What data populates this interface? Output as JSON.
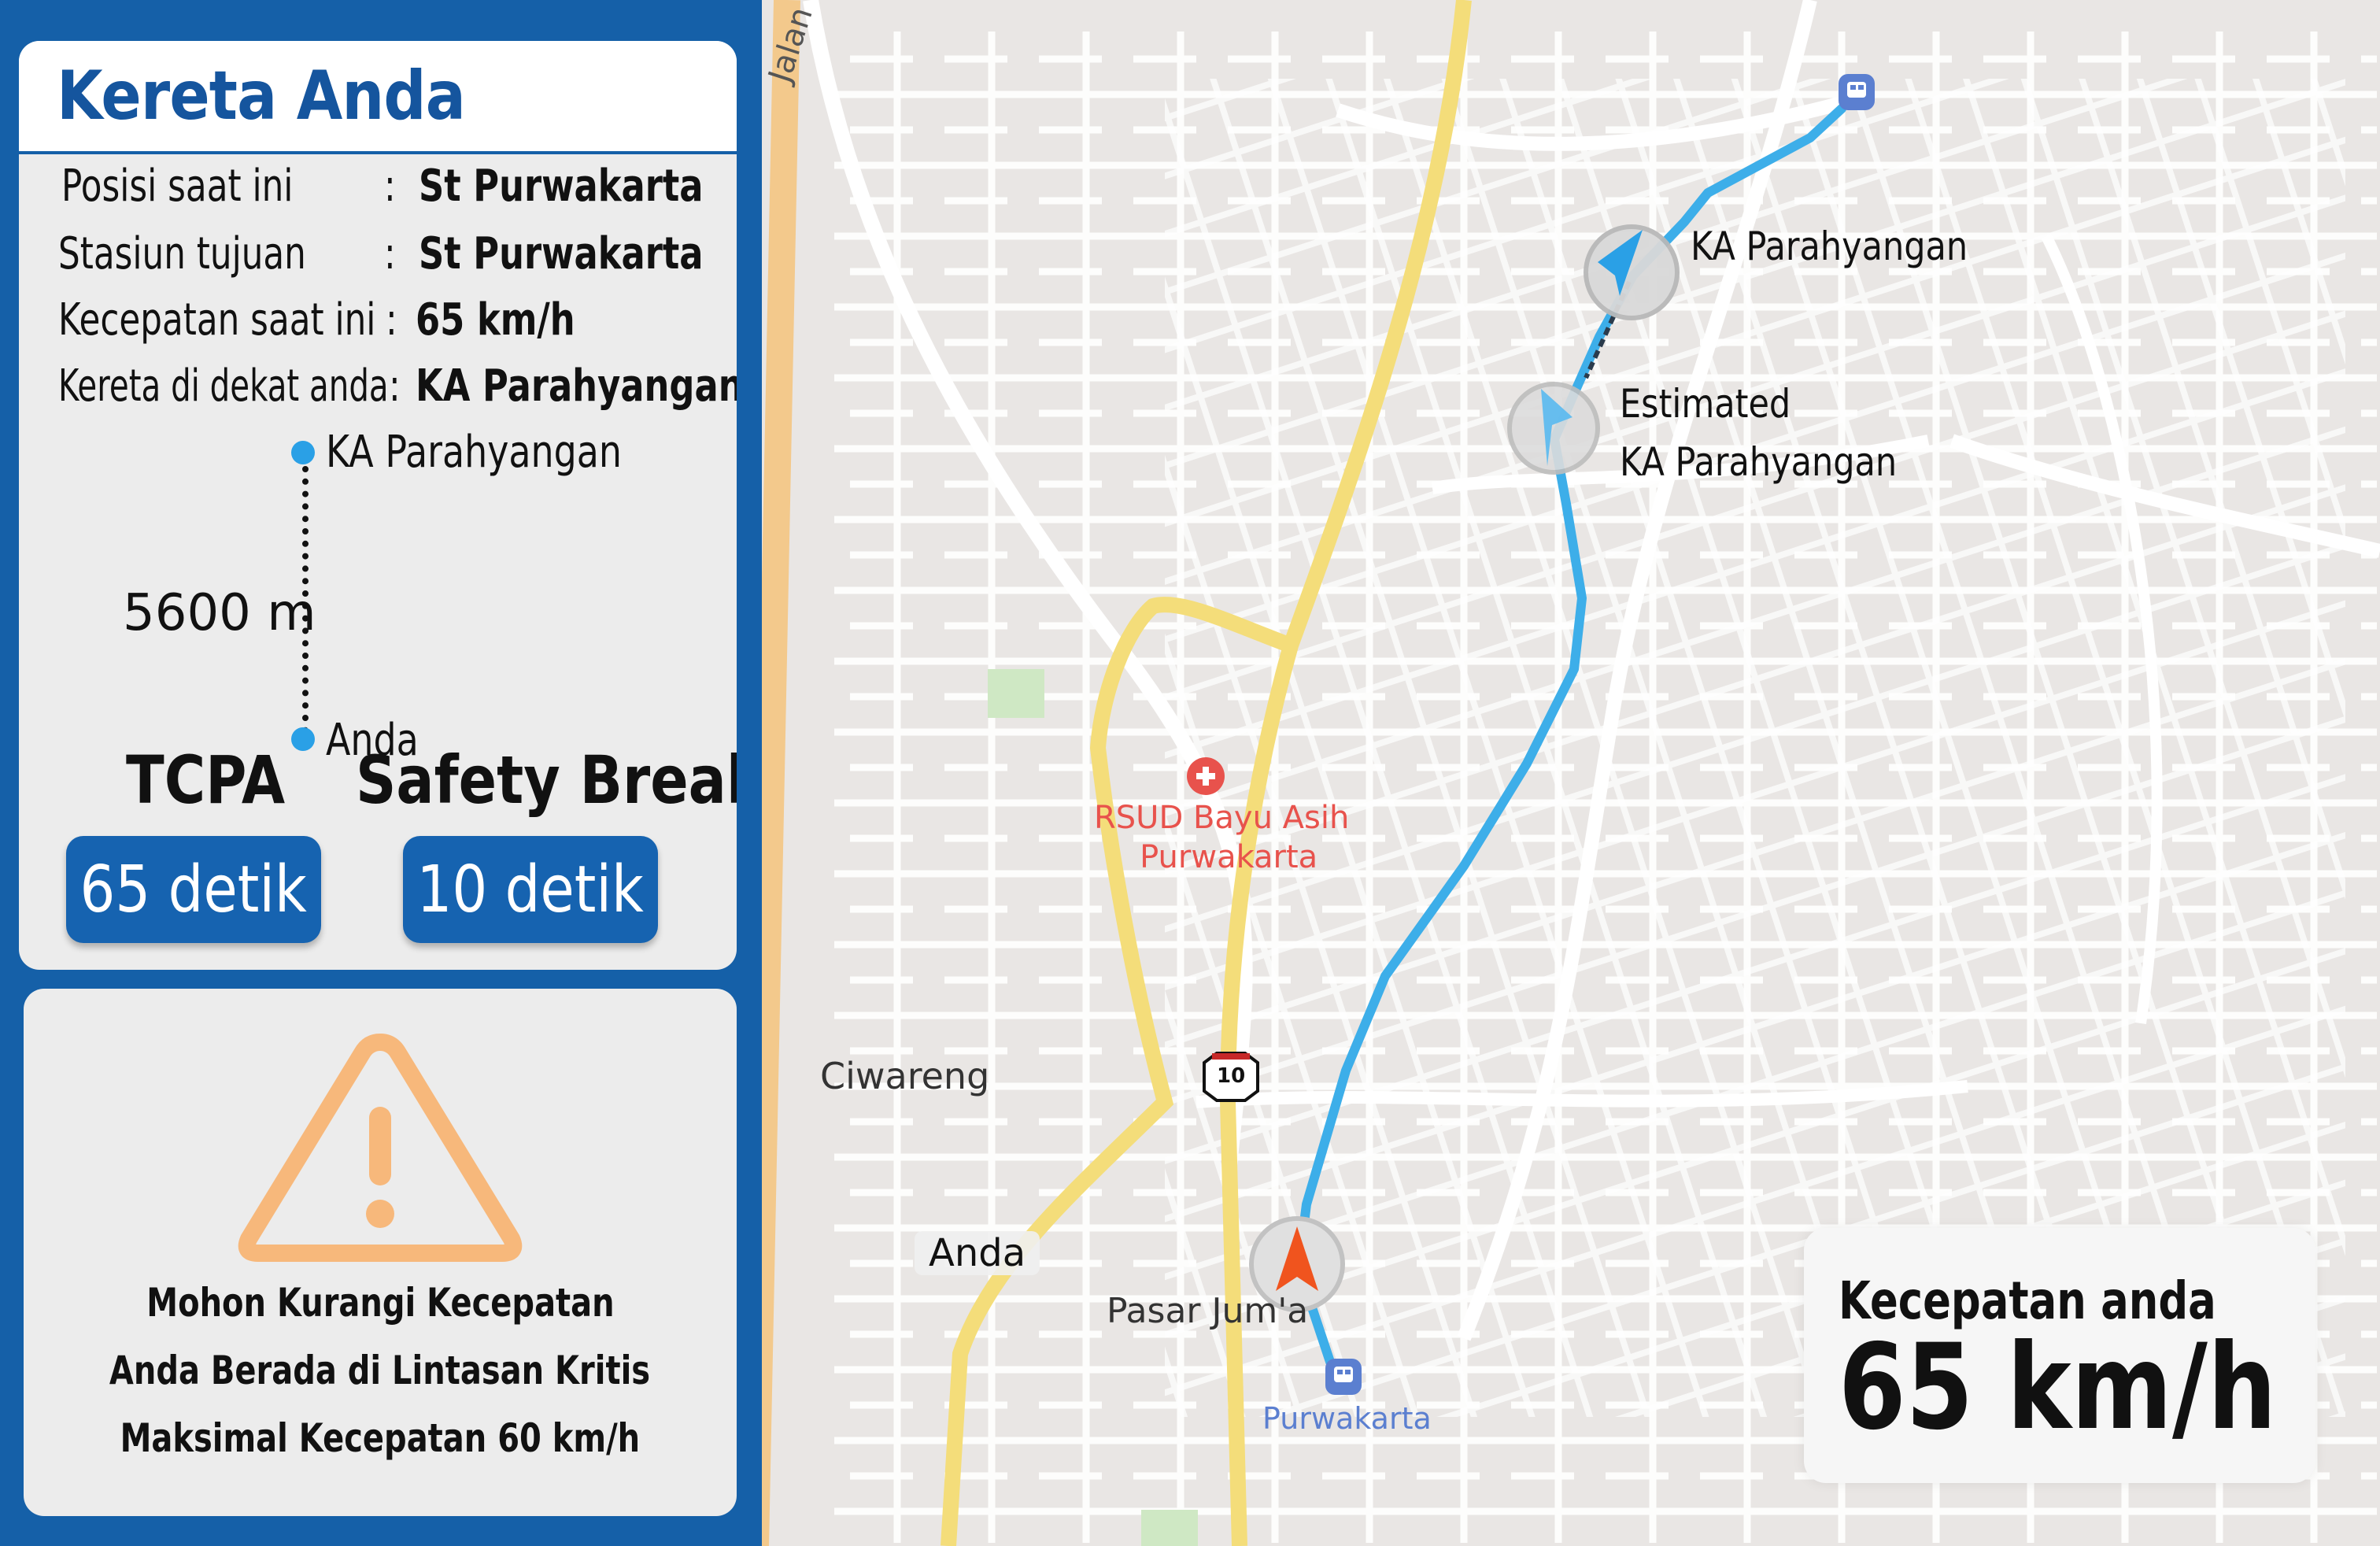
{
  "panel": {
    "title": "Kereta Anda",
    "rows": [
      {
        "label": "Posisi saat ini",
        "sep": ":",
        "value": "St Purwakarta"
      },
      {
        "label": "Stasiun tujuan",
        "sep": ":",
        "value": "St Purwakarta"
      },
      {
        "label": "Kecepatan saat ini",
        "sep": ":",
        "value": "65 km/h"
      },
      {
        "label": "Kereta di dekat anda",
        "sep": ":",
        "value": "KA Parahyangan"
      }
    ],
    "distance": {
      "top_label": "KA Parahyangan",
      "value": "5600 m",
      "bottom_label": "Anda"
    },
    "tcpa": {
      "title": "TCPA",
      "value": "65 detik"
    },
    "safety_break": {
      "title": "Safety Break",
      "value": "10 detik"
    }
  },
  "warning": {
    "icon": "warning-triangle-icon",
    "lines": [
      "Mohon Kurangi Kecepatan",
      "Anda Berada di Lintasan Kritis",
      "Maksimal Kecepatan 60 km/h"
    ]
  },
  "map": {
    "road_label": "Jalan Tol Cipularang",
    "hospital": "RSUD Bayu Asih\nPurwakarta",
    "hospital_line1": "RSUD Bayu Asih",
    "hospital_line2": "Purwakarta",
    "area_label": "Ciwareng",
    "route_shield": "10",
    "market_label": "Pasar Jum'a",
    "station_label": "Purwakarta",
    "train_label": "KA Parahyangan",
    "estimated_label_1": "Estimated",
    "estimated_label_2": "KA Parahyangan",
    "user_label": "Anda",
    "icons": [
      "hospital-icon",
      "train-station-icon",
      "navigation-arrow-icon"
    ]
  },
  "speed": {
    "title": "Kecepatan anda",
    "value": "65 km/h"
  },
  "colors": {
    "sidebar": "#1560a8",
    "pill": "#1663b0",
    "route": "#3daee9",
    "highway": "#f4dd7a",
    "warning": "#f7b87b",
    "user_arrow": "#f0541e",
    "hospital": "#e8524c"
  }
}
